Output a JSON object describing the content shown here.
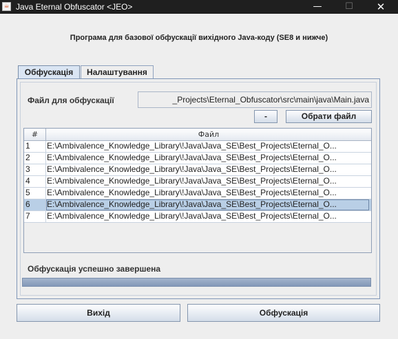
{
  "window": {
    "title": "Java Eternal Obfuscator <JEO>",
    "controls": {
      "minimize": "—",
      "maximize": "☐",
      "close": "✕"
    }
  },
  "heading": "Програма для базової обфускації вихідного Java-коду (SE8 и нижче)",
  "tabs": [
    {
      "label": "Обфускація",
      "selected": true
    },
    {
      "label": "Налаштування",
      "selected": false
    }
  ],
  "file_field": {
    "label": "Файл для обфускації",
    "value": "_Projects\\Eternal_Obfuscator\\src\\main\\java\\Main.java"
  },
  "buttons": {
    "remove": "-",
    "choose_file": "Обрати файл",
    "exit": "Вихід",
    "obfuscate": "Обфускація"
  },
  "table": {
    "columns": [
      "#",
      "Файл"
    ],
    "rows": [
      {
        "num": "1",
        "file": "E:\\Ambivalence_Knowledge_Library\\!Java\\Java_SE\\Best_Projects\\Eternal_O..."
      },
      {
        "num": "2",
        "file": "E:\\Ambivalence_Knowledge_Library\\!Java\\Java_SE\\Best_Projects\\Eternal_O..."
      },
      {
        "num": "3",
        "file": "E:\\Ambivalence_Knowledge_Library\\!Java\\Java_SE\\Best_Projects\\Eternal_O..."
      },
      {
        "num": "4",
        "file": "E:\\Ambivalence_Knowledge_Library\\!Java\\Java_SE\\Best_Projects\\Eternal_O..."
      },
      {
        "num": "5",
        "file": "E:\\Ambivalence_Knowledge_Library\\!Java\\Java_SE\\Best_Projects\\Eternal_O..."
      },
      {
        "num": "6",
        "file": "E:\\Ambivalence_Knowledge_Library\\!Java\\Java_SE\\Best_Projects\\Eternal_O..."
      },
      {
        "num": "7",
        "file": "E:\\Ambivalence_Knowledge_Library\\!Java\\Java_SE\\Best_Projects\\Eternal_O..."
      }
    ],
    "selected_row": "6"
  },
  "status": {
    "text": "Обфускація успешно завершена",
    "progress": 1.0
  }
}
